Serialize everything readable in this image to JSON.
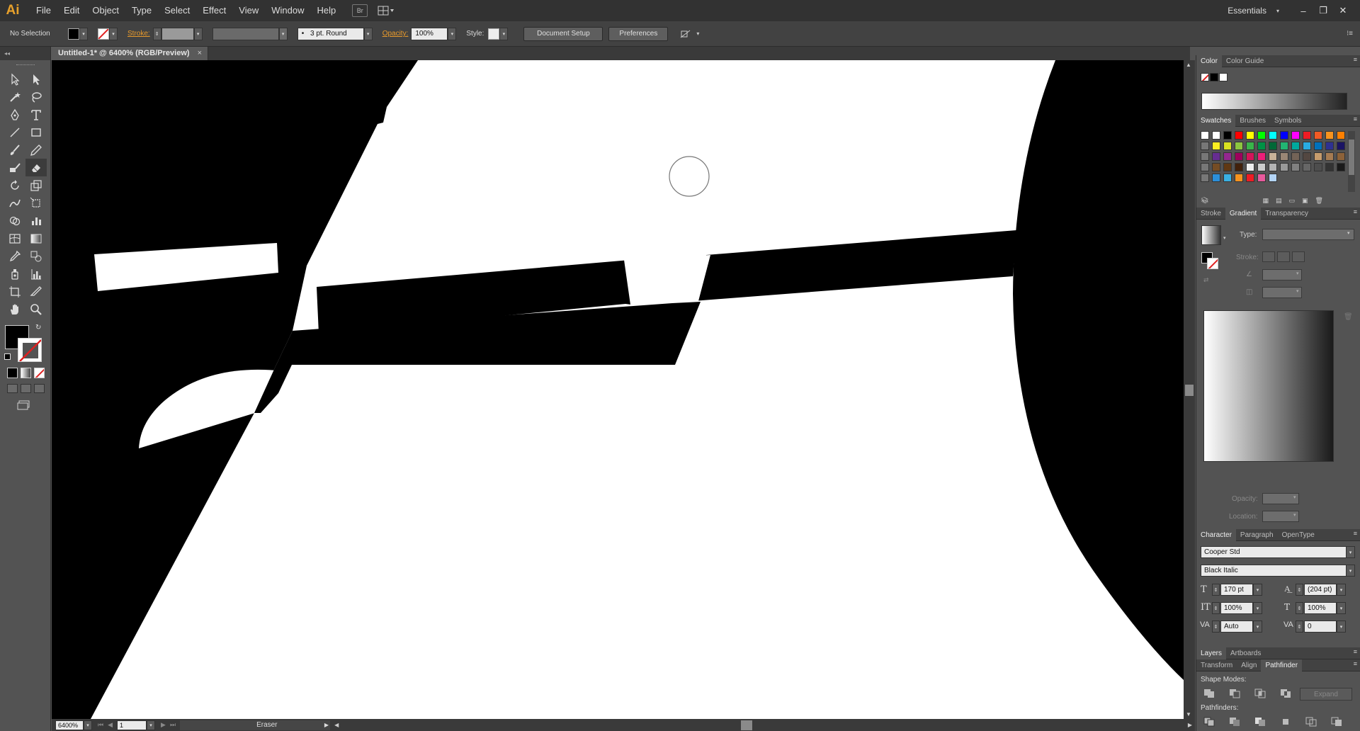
{
  "app": {
    "logo": "Ai",
    "workspace": "Essentials"
  },
  "menu": [
    "File",
    "Edit",
    "Object",
    "Type",
    "Select",
    "Effect",
    "View",
    "Window",
    "Help"
  ],
  "menubar_icons": {
    "bridge": "Br",
    "arrange": "arrange-documents-icon"
  },
  "window_controls": {
    "minimize": "–",
    "restore": "❐",
    "close": "✕"
  },
  "control": {
    "selection": "No Selection",
    "stroke_label": "Stroke:",
    "brush": "3 pt. Round",
    "brush_bullet": "•",
    "opacity_label": "Opacity:",
    "opacity_value": "100%",
    "style_label": "Style:",
    "document_setup": "Document Setup",
    "preferences": "Preferences"
  },
  "document_tab": {
    "title": "Untitled-1* @ 6400% (RGB/Preview)",
    "close": "×"
  },
  "statusbar": {
    "zoom": "6400%",
    "artboard": "1",
    "tool": "Eraser"
  },
  "panels": {
    "color_tabs": [
      "Color",
      "Color Guide"
    ],
    "swatch_tabs": [
      "Swatches",
      "Brushes",
      "Symbols"
    ],
    "gradient_tabs": [
      "Stroke",
      "Gradient",
      "Transparency"
    ],
    "gradient": {
      "type_label": "Type:",
      "stroke_label": "Stroke:",
      "opacity_label": "Opacity:",
      "location_label": "Location:"
    },
    "character_tabs": [
      "Character",
      "Paragraph",
      "OpenType"
    ],
    "character": {
      "font_family": "Cooper Std",
      "font_style": "Black Italic",
      "size": "170 pt",
      "leading": "(204 pt)",
      "vscale": "100%",
      "hscale": "100%",
      "kerning": "Auto",
      "tracking": "0"
    },
    "layers_tabs": [
      "Layers",
      "Artboards"
    ],
    "pathfinder_tabs": [
      "Transform",
      "Align",
      "Pathfinder"
    ],
    "pathfinder": {
      "shape_modes": "Shape Modes:",
      "expand": "Expand",
      "pathfinders": "Pathfinders:"
    }
  },
  "swatches": {
    "row1": [
      "#ffffff",
      "#000000",
      "#ff0000",
      "#ffff00",
      "#00ff00",
      "#00ffff",
      "#0000ff",
      "#ff00ff",
      "#ed1c24",
      "#f15a24",
      "#f7931e",
      "#ff8000"
    ],
    "row2": [
      "#fcee21",
      "#d9e021",
      "#8cc63f",
      "#39b54a",
      "#009245",
      "#006837",
      "#22b573",
      "#00a99d",
      "#29abe2",
      "#0071bc",
      "#2e3192",
      "#1b1464"
    ],
    "row3": [
      "#662d91",
      "#93278f",
      "#9e005d",
      "#d4145a",
      "#ed1e79",
      "#c7b299",
      "#998675",
      "#736357",
      "#534741",
      "#c69c6d",
      "#a67c52",
      "#8c6239"
    ],
    "row4": [
      "#754c24",
      "#603813",
      "#42210b",
      "#eeeeee",
      "#cccccc",
      "#b3b3b3",
      "#999999",
      "#808080",
      "#666666",
      "#4d4d4d",
      "#333333",
      "#1a1a1a"
    ],
    "row5": [
      "#2b8fd9",
      "#3ab0e2",
      "#f7931e",
      "#ed1c24",
      "#e85a9c",
      "#b3d4f5"
    ]
  }
}
